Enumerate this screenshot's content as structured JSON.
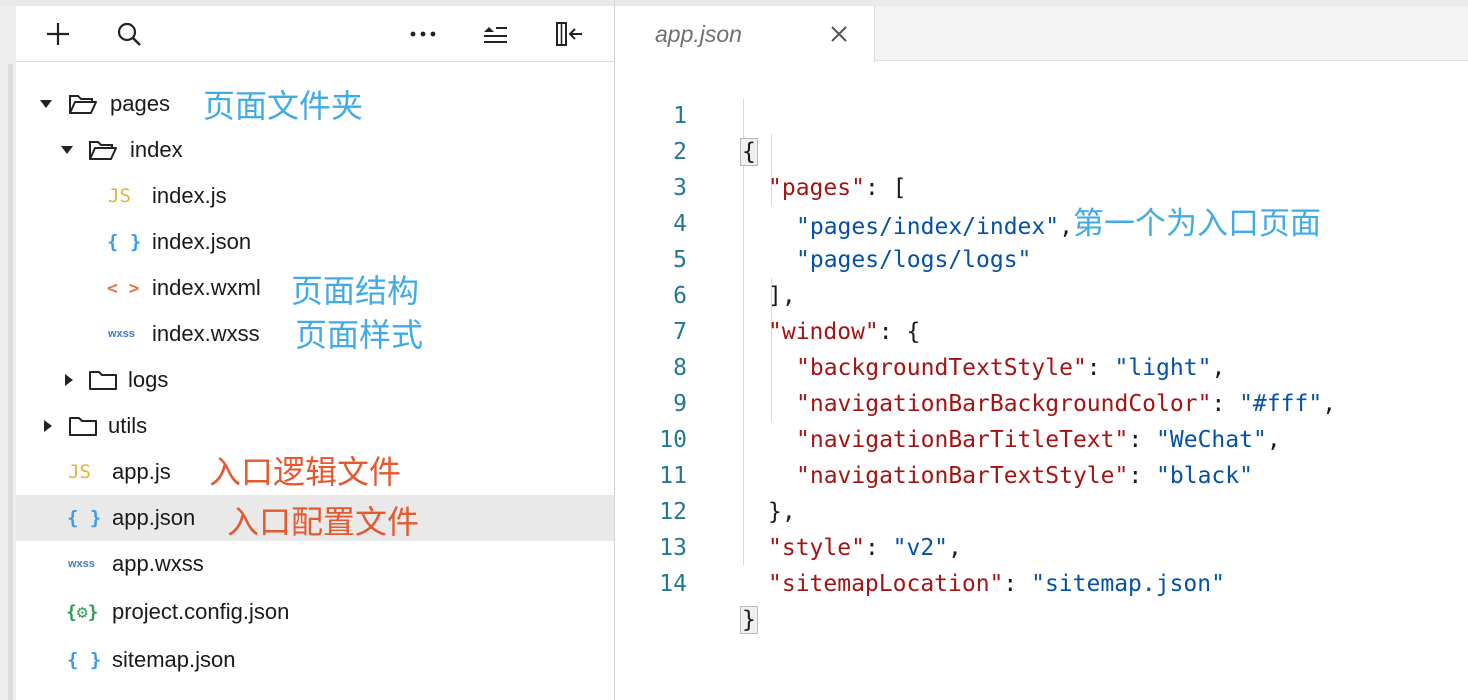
{
  "explorer": {
    "toolbar": {
      "add_icon": "plus-icon",
      "search_icon": "search-icon",
      "more_icon": "ellipsis-icon",
      "collapse_icon": "collapse-all-icon",
      "panel_icon": "hide-panel-icon"
    },
    "tree": [
      {
        "label": "pages",
        "type": "folder",
        "open": true,
        "depth": 0
      },
      {
        "label": "index",
        "type": "folder",
        "open": true,
        "depth": 1
      },
      {
        "label": "index.js",
        "type": "js",
        "icon_text": "JS",
        "depth": 2
      },
      {
        "label": "index.json",
        "type": "json",
        "icon_text": "{ }",
        "depth": 2
      },
      {
        "label": "index.wxml",
        "type": "wxml",
        "icon_text": "< >",
        "depth": 2
      },
      {
        "label": "index.wxss",
        "type": "wxss",
        "icon_text": "wxss",
        "depth": 2
      },
      {
        "label": "logs",
        "type": "folder",
        "open": false,
        "depth": 1
      },
      {
        "label": "utils",
        "type": "folder",
        "open": false,
        "depth": 0
      },
      {
        "label": "app.js",
        "type": "js",
        "icon_text": "JS",
        "depth": 0
      },
      {
        "label": "app.json",
        "type": "json",
        "icon_text": "{ }",
        "depth": 0,
        "selected": true
      },
      {
        "label": "app.wxss",
        "type": "wxss",
        "icon_text": "wxss",
        "depth": 0
      },
      {
        "label": "project.config.json",
        "type": "config",
        "icon_text": "{⚙}",
        "depth": 0
      },
      {
        "label": "sitemap.json",
        "type": "json",
        "icon_text": "{ }",
        "depth": 0
      }
    ],
    "annotations": {
      "pages": "页面文件夹",
      "wxml": "页面结构",
      "wxss": "页面样式",
      "appjs": "入口逻辑文件",
      "appjson": "入口配置文件"
    }
  },
  "editor": {
    "tab": {
      "label": "app.json",
      "close_icon": "close-icon"
    },
    "code_annotation": "第一个为入口页面",
    "lines": [
      {
        "n": "1"
      },
      {
        "n": "2"
      },
      {
        "n": "3"
      },
      {
        "n": "4"
      },
      {
        "n": "5"
      },
      {
        "n": "6"
      },
      {
        "n": "7"
      },
      {
        "n": "8"
      },
      {
        "n": "9"
      },
      {
        "n": "10"
      },
      {
        "n": "11"
      },
      {
        "n": "12"
      },
      {
        "n": "13"
      },
      {
        "n": "14"
      }
    ],
    "tokens": {
      "open_brace": "{",
      "close_brace": "}",
      "pages_key": "\"pages\"",
      "pages_open": ": [",
      "page_index": "\"pages/index/index\"",
      "page_logs": "\"pages/logs/logs\"",
      "comma": ",",
      "pages_close": "],",
      "window_key": "\"window\"",
      "window_open": ": {",
      "bts_key": "\"backgroundTextStyle\"",
      "bts_val": "\"light\"",
      "nbbc_key": "\"navigationBarBackgroundColor\"",
      "nbbc_val": "\"#fff\"",
      "nbtt_key": "\"navigationBarTitleText\"",
      "nbtt_val": "\"WeChat\"",
      "nbts_key": "\"navigationBarTextStyle\"",
      "nbts_val": "\"black\"",
      "window_close": "},",
      "style_key": "\"style\"",
      "style_val": "\"v2\"",
      "sitemap_key": "\"sitemapLocation\"",
      "sitemap_val": "\"sitemap.json\"",
      "colon": ": "
    }
  }
}
